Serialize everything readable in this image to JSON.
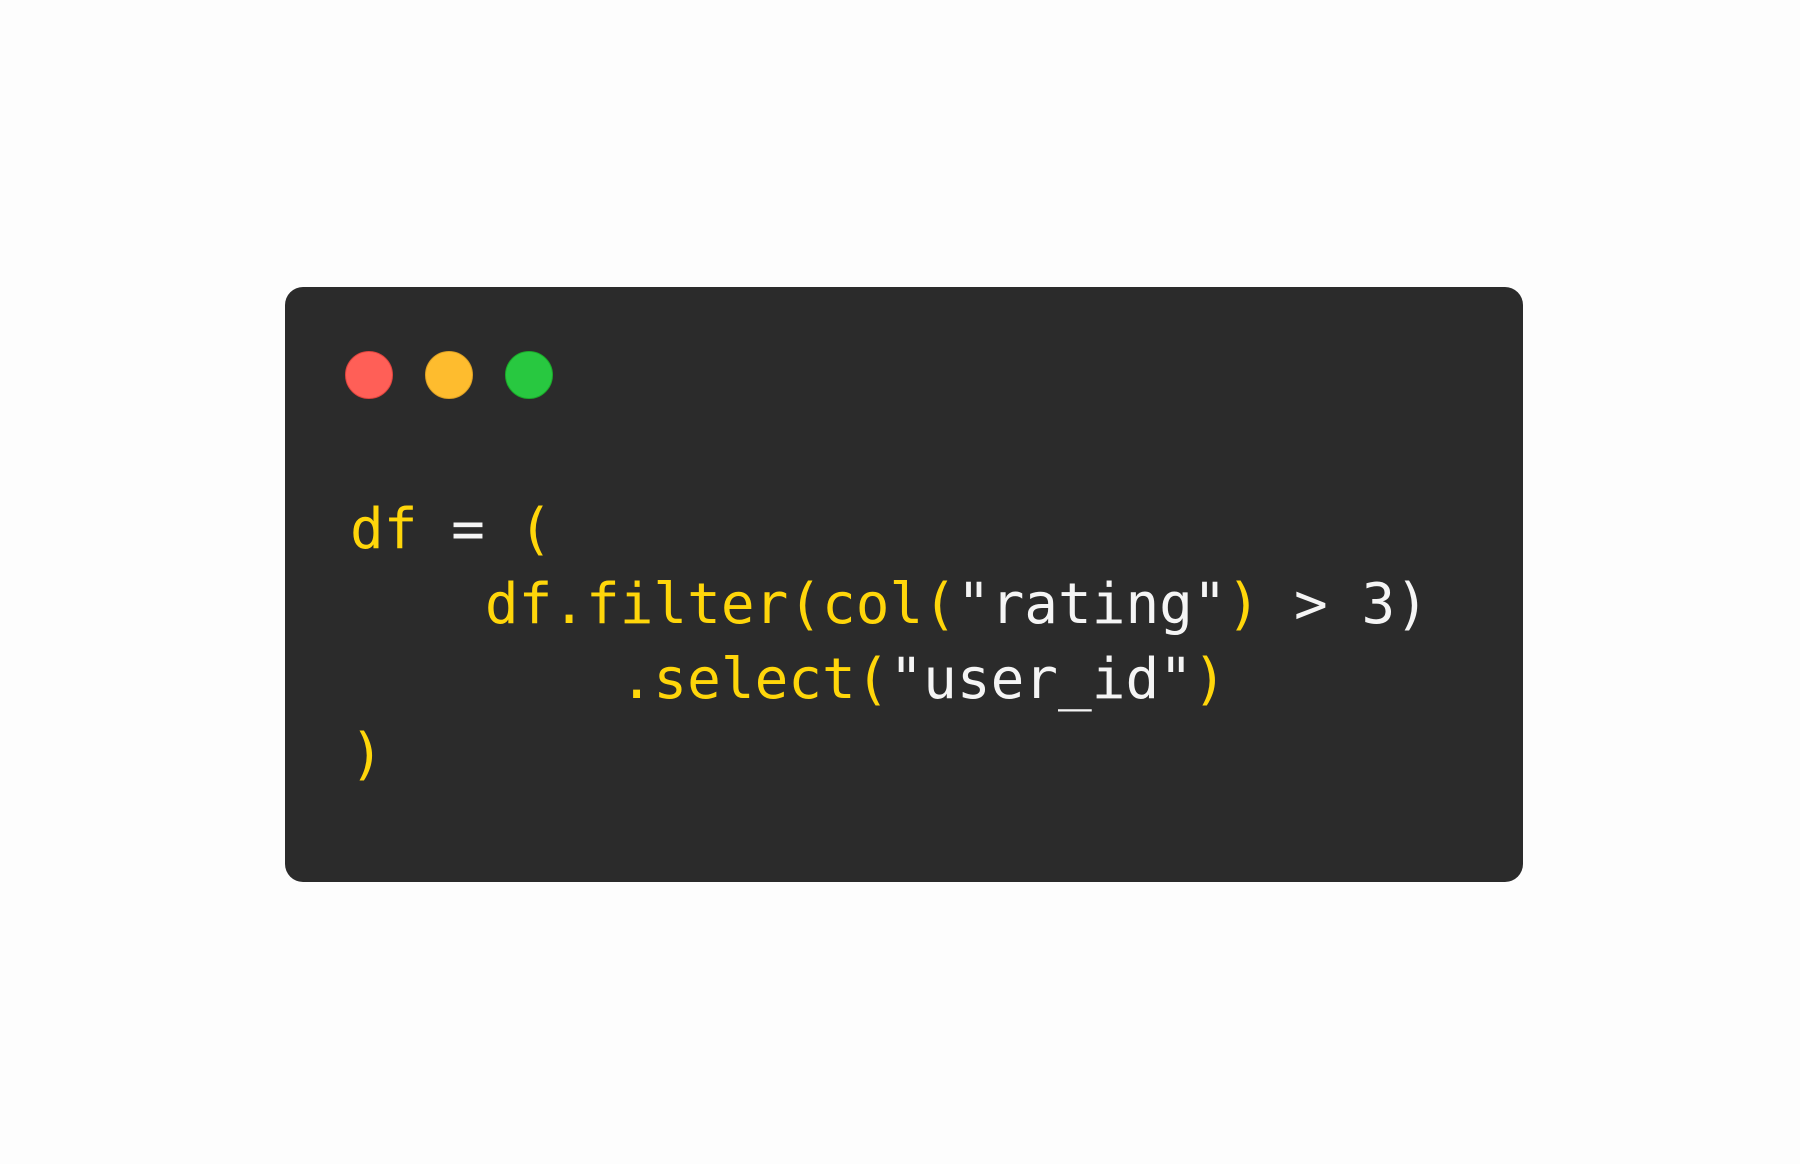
{
  "window": {
    "controls": {
      "close": "close-button",
      "minimize": "minimize-button",
      "zoom": "zoom-button"
    }
  },
  "colors": {
    "background": "#fdfdfd",
    "window": "#2b2b2b",
    "accent": "#ffd60a",
    "text": "#f5f5f5",
    "close": "#ff5f57",
    "minimize": "#febc2e",
    "zoom": "#28c840"
  },
  "code": {
    "lines": [
      {
        "tokens": [
          {
            "text": "df",
            "color": "yellow"
          },
          {
            "text": " = ",
            "color": "white"
          },
          {
            "text": "(",
            "color": "yellow"
          }
        ]
      },
      {
        "tokens": [
          {
            "text": "    df.filter(col(",
            "color": "yellow"
          },
          {
            "text": "\"rating\"",
            "color": "white"
          },
          {
            "text": ")",
            "color": "yellow"
          },
          {
            "text": " > 3)",
            "color": "white"
          }
        ]
      },
      {
        "tokens": [
          {
            "text": "        .select(",
            "color": "yellow"
          },
          {
            "text": "\"user_id\"",
            "color": "white"
          },
          {
            "text": ")",
            "color": "yellow"
          }
        ]
      },
      {
        "tokens": [
          {
            "text": ")",
            "color": "yellow"
          }
        ]
      }
    ]
  }
}
